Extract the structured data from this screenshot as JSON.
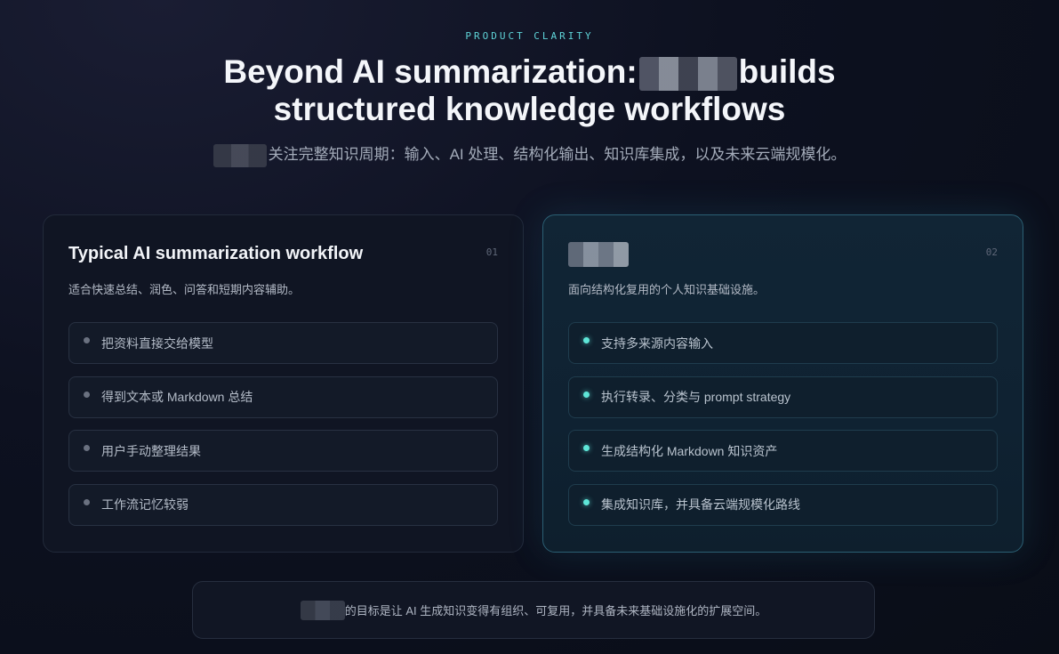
{
  "header": {
    "eyebrow": "PRODUCT CLARITY",
    "title_part1": "Beyond AI summarization:",
    "title_part2": "builds",
    "title_line2": "structured knowledge workflows",
    "subtitle": "关注完整知识周期：输入、AI 处理、结构化输出、知识库集成，以及未来云端规模化。"
  },
  "cards": {
    "typical": {
      "title": "Typical AI summarization workflow",
      "number": "01",
      "description": "适合快速总结、润色、问答和短期内容辅助。",
      "items": [
        "把资料直接交给模型",
        "得到文本或 Markdown 总结",
        "用户手动整理结果",
        "工作流记忆较弱"
      ]
    },
    "product": {
      "number": "02",
      "description": "面向结构化复用的个人知识基础设施。",
      "items": [
        "支持多来源内容输入",
        "执行转录、分类与 prompt strategy",
        "生成结构化 Markdown 知识资产",
        "集成知识库，并具备云端规模化路线"
      ]
    }
  },
  "footer": {
    "text": "的目标是让 AI 生成知识变得有组织、可复用，并具备未来基础设施化的扩展空间。"
  },
  "colors": {
    "accent": "#5ee6d8",
    "eyebrow": "#5fd4d8",
    "background": "#0b0f1a"
  }
}
